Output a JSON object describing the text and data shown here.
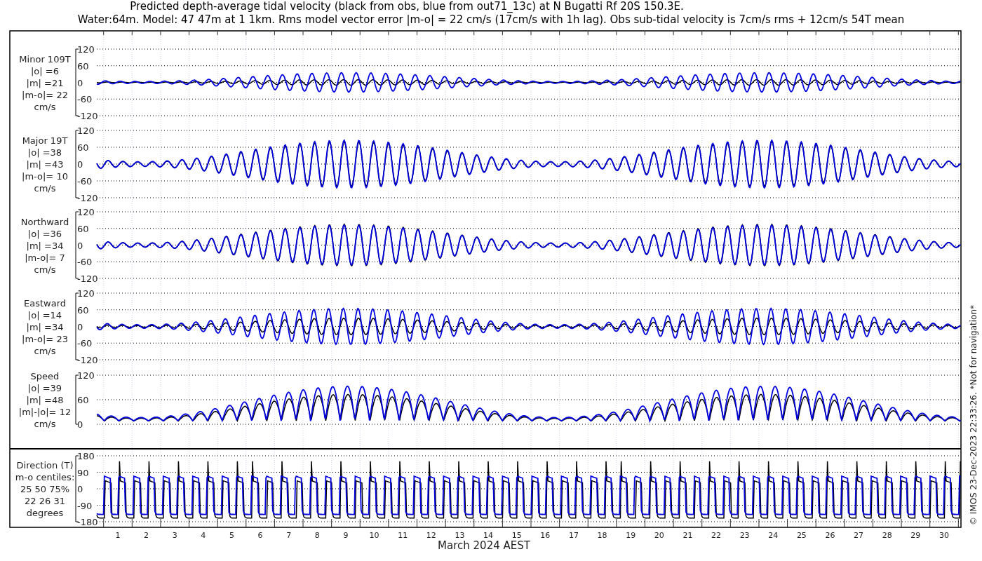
{
  "title_lines": [
    "Predicted depth-average tidal velocity (black from obs, blue from out71_13c) at N Bugatti Rf 20S 150.3E.",
    "Water:64m. Model: 47 47m at 1 1km. Rms model vector error |m-o| = 22 cm/s (17cm/s with 1h lag). Obs sub-tidal velocity is 7cm/s rms + 12cm/s 54T mean"
  ],
  "panels": [
    {
      "kind": "minor",
      "label_lines": [
        "Minor 109T",
        "|o| =6",
        "|m| =21",
        "|m-o|= 22",
        "cm/s"
      ],
      "yticks": [
        "120",
        "60",
        "0",
        "-60",
        "-120"
      ]
    },
    {
      "kind": "major",
      "label_lines": [
        "Major 19T",
        "|o| =38",
        "|m| =43",
        "|m-o|= 10",
        "cm/s"
      ],
      "yticks": [
        "120",
        "60",
        "0",
        "-60",
        "-120"
      ]
    },
    {
      "kind": "north",
      "label_lines": [
        "Northward",
        "|o| =36",
        "|m| =34",
        "|m-o|= 7",
        "cm/s"
      ],
      "yticks": [
        "120",
        "60",
        "0",
        "-60",
        "-120"
      ]
    },
    {
      "kind": "east",
      "label_lines": [
        "Eastward",
        "|o| =14",
        "|m| =34",
        "|m-o|= 23",
        "cm/s"
      ],
      "yticks": [
        "120",
        "60",
        "0",
        "-60",
        "-120"
      ]
    },
    {
      "kind": "speed",
      "label_lines": [
        "Speed",
        "|o| =39",
        "|m| =48",
        "|m|-|o|= 12",
        "cm/s"
      ],
      "yticks": [
        "120",
        "60",
        "0"
      ]
    },
    {
      "kind": "direction",
      "label_lines": [
        "Direction (T)",
        "m-o centiles:",
        "25  50  75%",
        "22  26  31",
        "degrees"
      ],
      "yticks": [
        "180",
        "90",
        "0",
        "-90",
        "-180"
      ]
    }
  ],
  "x_axis": {
    "ticks": [
      "1",
      "2",
      "3",
      "4",
      "5",
      "6",
      "7",
      "8",
      "9",
      "10",
      "11",
      "12",
      "13",
      "14",
      "15",
      "16",
      "17",
      "18",
      "19",
      "20",
      "21",
      "22",
      "23",
      "24",
      "25",
      "26",
      "27",
      "28",
      "29",
      "30"
    ],
    "label": "March 2024 AEST"
  },
  "credit": "© IMOS 23-Dec-2023 22:33:26.  *Not for navigation*"
}
